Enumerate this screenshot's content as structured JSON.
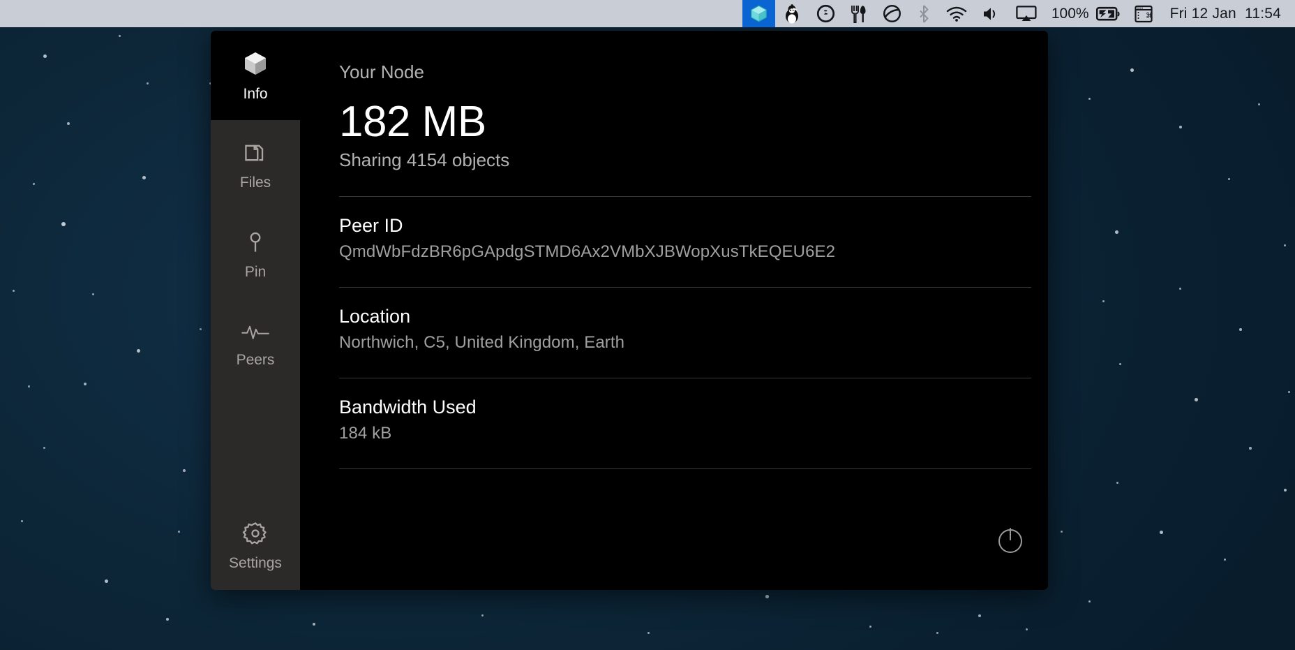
{
  "menubar": {
    "icons": [
      {
        "name": "ipfs-cube-icon",
        "label": "IPFS",
        "active": true
      },
      {
        "name": "penguin-icon",
        "label": "Penguin"
      },
      {
        "name": "circle-badge-icon",
        "label": "Status"
      },
      {
        "name": "cutlery-icon",
        "label": "Eat"
      },
      {
        "name": "circle-curve-icon",
        "label": "Display"
      },
      {
        "name": "bluetooth-icon",
        "label": "Bluetooth",
        "dim": true
      },
      {
        "name": "wifi-icon",
        "label": "Wi-Fi"
      },
      {
        "name": "volume-icon",
        "label": "Volume"
      },
      {
        "name": "airplay-icon",
        "label": "AirPlay"
      }
    ],
    "battery_percent": "100%",
    "battery_icon": "battery-charging-icon",
    "keyboard_icon": "keyboard-shortcut-icon",
    "clock": "Fri 12 Jan  11:54"
  },
  "sidebar": {
    "items": [
      {
        "label": "Info",
        "icon": "cube-icon",
        "active": true
      },
      {
        "label": "Files",
        "icon": "files-icon",
        "active": false
      },
      {
        "label": "Pin",
        "icon": "pin-icon",
        "active": false
      },
      {
        "label": "Peers",
        "icon": "pulse-icon",
        "active": false
      },
      {
        "label": "Settings",
        "icon": "gear-icon",
        "active": false
      }
    ]
  },
  "content": {
    "kicker": "Your Node",
    "repo_size": "182 MB",
    "sharing": "Sharing 4154 objects",
    "rows": [
      {
        "title": "Peer ID",
        "value": "QmdWbFdzBR6pGApdgSTMD6Ax2VMbXJBWopXusTkEQEU6E2"
      },
      {
        "title": "Location",
        "value": "Northwich, C5, United Kingdom, Earth"
      },
      {
        "title": "Bandwidth Used",
        "value": "184 kB"
      }
    ],
    "power_button": "power-icon"
  },
  "colors": {
    "accent": "#0a64d2",
    "menubar_bg": "#c9ced6",
    "sidebar_bg": "#2b2a29",
    "content_bg": "#000000",
    "desktop_bg": "#0d2739"
  }
}
